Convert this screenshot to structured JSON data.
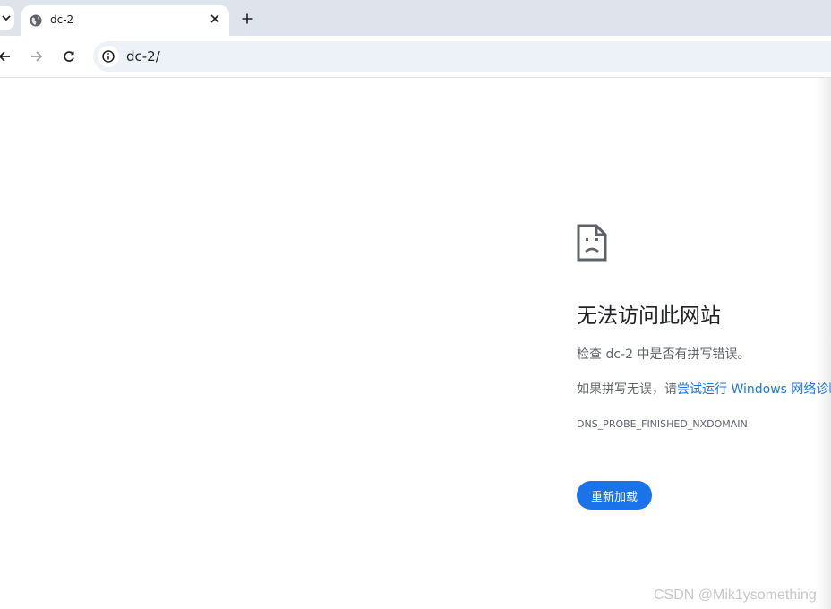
{
  "tabstrip": {
    "tab": {
      "title": "dc-2"
    },
    "icons": {
      "tab_search": "chevron-down-icon",
      "favicon": "globe-icon",
      "close": "close-icon",
      "new_tab": "plus-icon"
    }
  },
  "toolbar": {
    "url": "dc-2/",
    "icons": {
      "back": "arrow-left-icon",
      "forward": "arrow-right-icon",
      "reload": "reload-icon",
      "site_info": "info-icon"
    }
  },
  "error_page": {
    "icon": "sad-document-icon",
    "title": "无法访问此网站",
    "line1": "检查 dc-2 中是否有拼写错误。",
    "line2_prefix": "如果拼写无误，请",
    "line2_link": "尝试运行 Windows 网络诊断",
    "error_code": "DNS_PROBE_FINISHED_NXDOMAIN",
    "reload_button": "重新加载"
  },
  "watermark": "CSDN @Mik1ysomething",
  "colors": {
    "tabstrip_bg": "#dfe3eb",
    "omnibox_bg": "#edf1f8",
    "link": "#1a73e8",
    "button_bg": "#1a73e8"
  }
}
